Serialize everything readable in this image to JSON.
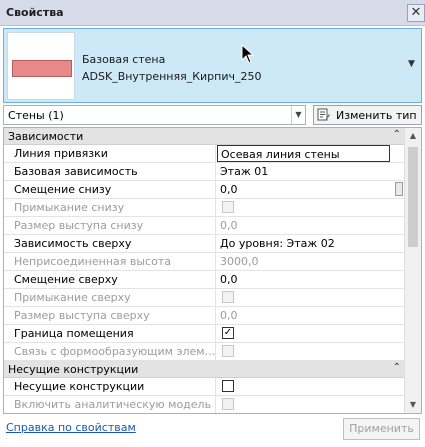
{
  "window": {
    "title": "Свойства",
    "close_glyph": "✕"
  },
  "type_selector": {
    "family": "Базовая стена",
    "type_name": "ADSK_Внутренняя_Кирпич_250",
    "swatch_color": "#e88888",
    "arrow_glyph": "▼"
  },
  "filter": {
    "selected": "Стены (1)",
    "dropdown_glyph": "▼"
  },
  "edit_type_button": {
    "label": "Изменить тип",
    "icon": "edit-type-icon"
  },
  "sections": [
    {
      "label": "Зависимости",
      "collapse_glyph": "⌃",
      "rows": [
        {
          "name": "Линия привязки",
          "value": "Осевая линия стены",
          "enabled": true
        },
        {
          "name": "Базовая зависимость",
          "value": "Этаж 01",
          "enabled": true
        },
        {
          "name": "Смещение снизу",
          "value": "0,0",
          "enabled": true
        },
        {
          "name": "Примыкание снизу",
          "checkbox": false,
          "enabled": false
        },
        {
          "name": "Размер выступа снизу",
          "value": "0,0",
          "enabled": false
        },
        {
          "name": "Зависимость сверху",
          "value": "До уровня: Этаж 02",
          "enabled": true
        },
        {
          "name": "Неприсоединенная высота",
          "value": "3000,0",
          "enabled": false
        },
        {
          "name": "Смещение сверху",
          "value": "0,0",
          "enabled": true
        },
        {
          "name": "Примыкание сверху",
          "checkbox": false,
          "enabled": false
        },
        {
          "name": "Размер выступа сверху",
          "value": "0,0",
          "enabled": false
        },
        {
          "name": "Граница помещения",
          "checkbox": true,
          "enabled": true
        },
        {
          "name": "Связь с формообразующим элем...",
          "checkbox": false,
          "enabled": false
        }
      ]
    },
    {
      "label": "Несущие конструкции",
      "collapse_glyph": "⌃",
      "rows": [
        {
          "name": "Несущие конструкции",
          "checkbox": false,
          "enabled": true
        },
        {
          "name": "Включить аналитическую модель",
          "checkbox": false,
          "enabled": false
        }
      ]
    }
  ],
  "footer": {
    "help_link": "Справка по свойствам",
    "apply_label": "Применить"
  }
}
